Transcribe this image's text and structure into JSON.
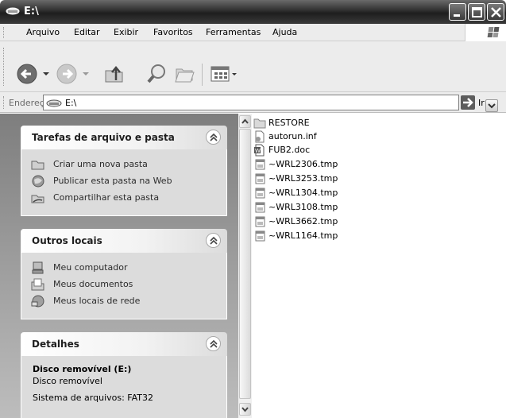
{
  "window": {
    "title": "E:\\"
  },
  "menu": {
    "items": [
      "Arquivo",
      "Editar",
      "Exibir",
      "Favoritos",
      "Ferramentas",
      "Ajuda"
    ]
  },
  "toolbar": {
    "buttons": [
      "back-icon",
      "forward-icon",
      "up-folder-icon",
      "search-icon",
      "folders-icon",
      "views-icon"
    ]
  },
  "address": {
    "label": "Endereço",
    "value": "E:\\",
    "go_label": "Ir"
  },
  "tasks_panel": {
    "title": "Tarefas de arquivo e pasta",
    "items": [
      {
        "label": "Criar uma nova pasta",
        "icon": "new-folder-icon"
      },
      {
        "label": "Publicar esta pasta na Web",
        "icon": "publish-web-icon"
      },
      {
        "label": "Compartilhar esta pasta",
        "icon": "share-folder-icon"
      }
    ]
  },
  "places_panel": {
    "title": "Outros locais",
    "items": [
      {
        "label": "Meu computador",
        "icon": "computer-icon"
      },
      {
        "label": "Meus documentos",
        "icon": "documents-icon"
      },
      {
        "label": "Meus locais de rede",
        "icon": "network-icon"
      }
    ]
  },
  "details_panel": {
    "title": "Detalhes",
    "name": "Disco removível (E:)",
    "type": "Disco removível",
    "filesystem": "Sistema de arquivos: FAT32"
  },
  "files": [
    {
      "name": "RESTORE",
      "icon": "folder-icon"
    },
    {
      "name": "autorun.inf",
      "icon": "inf-file-icon"
    },
    {
      "name": "FUB2.doc",
      "icon": "doc-file-icon"
    },
    {
      "name": "~WRL2306.tmp",
      "icon": "tmp-file-icon"
    },
    {
      "name": "~WRL3253.tmp",
      "icon": "tmp-file-icon"
    },
    {
      "name": "~WRL1304.tmp",
      "icon": "tmp-file-icon"
    },
    {
      "name": "~WRL3108.tmp",
      "icon": "tmp-file-icon"
    },
    {
      "name": "~WRL3662.tmp",
      "icon": "tmp-file-icon"
    },
    {
      "name": "~WRL1164.tmp",
      "icon": "tmp-file-icon"
    }
  ]
}
